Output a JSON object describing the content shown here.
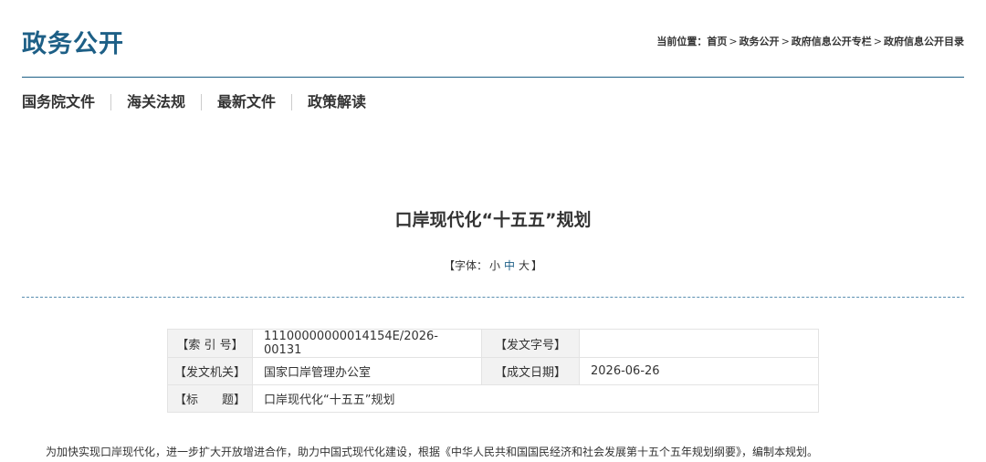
{
  "header": {
    "site_title": "政务公开",
    "breadcrumb": {
      "prefix": "当前位置：",
      "items": [
        "首页",
        "政务公开",
        "政府信息公开专栏",
        "政府信息公开目录"
      ],
      "separator": ">"
    }
  },
  "subnav": {
    "items": [
      "国务院文件",
      "海关法规",
      "最新文件",
      "政策解读"
    ]
  },
  "article": {
    "title": "口岸现代化“十五五”规划",
    "font_size": {
      "prefix": "【字体：",
      "small": "小",
      "medium": "中",
      "large": "大",
      "suffix": "】",
      "selected": "中"
    },
    "meta": {
      "index_label": "【索 引 号】",
      "index_value": "11100000000014154E/2026-00131",
      "doc_no_label": "【发文字号】",
      "doc_no_value": "",
      "issuer_label": "【发文机关】",
      "issuer_value": "国家口岸管理办公室",
      "date_label": "【成文日期】",
      "date_value": "2026-06-26",
      "subject_label": "【标　　题】",
      "subject_value": "口岸现代化“十五五”规划"
    },
    "body": "为加快实现口岸现代化，进一步扩大开放增进合作，助力中国式现代化建设，根据《中华人民共和国国民经济和社会发展第十五个五年规划纲要》，编制本规划。"
  },
  "colors": {
    "accent": "#1d5f86",
    "text": "#333333",
    "table_label_bg": "#f2f2f2"
  }
}
